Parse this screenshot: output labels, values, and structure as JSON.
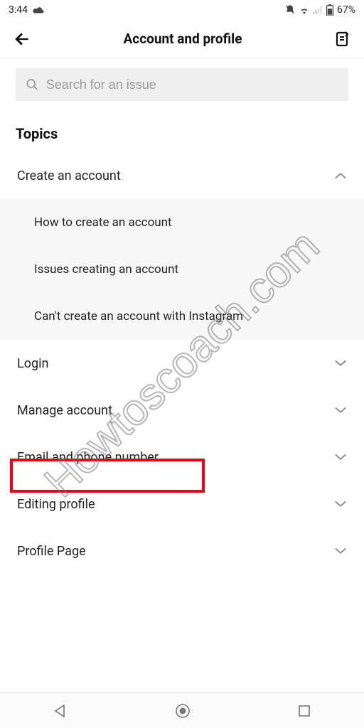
{
  "status": {
    "time": "3:44",
    "battery": "67%"
  },
  "header": {
    "title": "Account and profile"
  },
  "search": {
    "placeholder": "Search for an issue"
  },
  "topics_heading": "Topics",
  "topics": [
    {
      "label": "Create an account",
      "expanded": true,
      "items": [
        {
          "label": "How to create an account"
        },
        {
          "label": "Issues creating an account"
        },
        {
          "label": "Can't create an account with Instagram"
        }
      ]
    },
    {
      "label": "Login"
    },
    {
      "label": "Manage account"
    },
    {
      "label": "Email and phone number"
    },
    {
      "label": "Editing profile"
    },
    {
      "label": "Profile Page"
    }
  ],
  "watermark": "Howtoscoach.com"
}
